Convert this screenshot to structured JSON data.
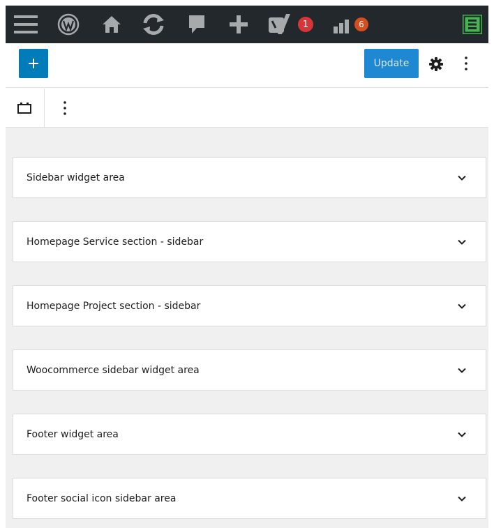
{
  "admin_bar": {
    "items": [
      {
        "icon": "menu-icon"
      },
      {
        "icon": "wordpress-logo-icon"
      },
      {
        "icon": "home-icon"
      },
      {
        "icon": "refresh-icon"
      },
      {
        "icon": "comment-icon"
      },
      {
        "icon": "plus-icon"
      },
      {
        "icon": "yoast-icon",
        "badge": "1",
        "badge_color": "#d63638"
      },
      {
        "icon": "stats-icon",
        "badge": "6",
        "badge_color": "#d54e21"
      },
      {
        "icon": "elementor-icon",
        "color": "#46b450"
      }
    ]
  },
  "header": {
    "update_label": "Update"
  },
  "colors": {
    "accent": "#007cba",
    "admin_bar_bg": "#23282d",
    "content_bg": "#f0f0f0"
  },
  "widget_areas": [
    {
      "title": "Sidebar widget area"
    },
    {
      "title": "Homepage Service section - sidebar"
    },
    {
      "title": "Homepage Project section - sidebar"
    },
    {
      "title": "Woocommerce sidebar widget area"
    },
    {
      "title": "Footer widget area"
    },
    {
      "title": "Footer social icon sidebar area"
    }
  ]
}
